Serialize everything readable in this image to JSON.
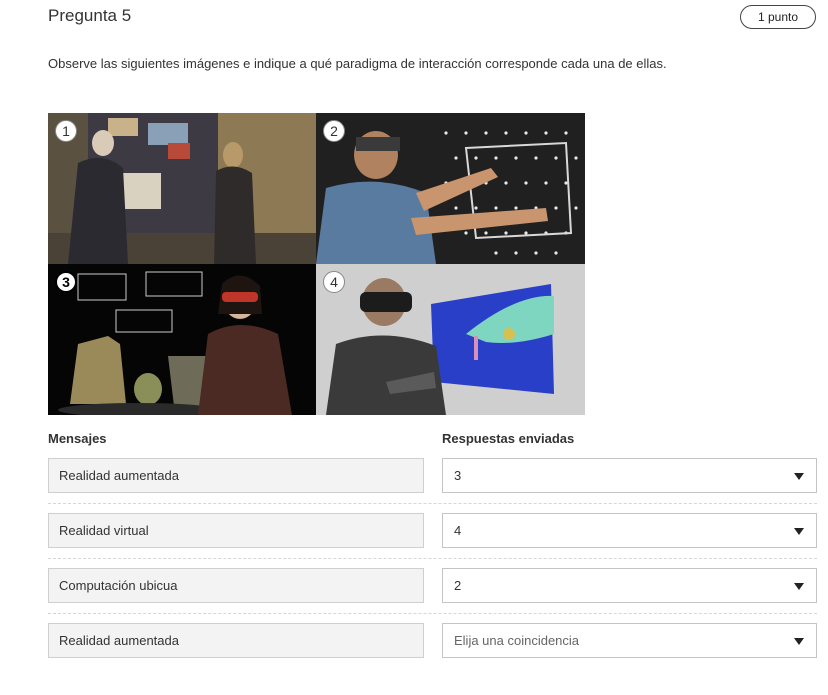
{
  "question": {
    "title": "Pregunta 5",
    "points": "1 punto",
    "instructions": "Observe las siguientes imágenes e indique a qué paradigma de interacción corresponde cada una de ellas."
  },
  "figure": {
    "panels": [
      {
        "number": "1",
        "icon": "people-at-display-wall"
      },
      {
        "number": "2",
        "icon": "man-with-headset-at-pegboard"
      },
      {
        "number": "3",
        "icon": "woman-with-glasses-museum-artifacts"
      },
      {
        "number": "4",
        "icon": "man-with-vr-headset-and-gloves"
      }
    ]
  },
  "matching": {
    "header_left": "Mensajes",
    "header_right": "Respuestas enviadas",
    "rows": [
      {
        "message": "Realidad aumentada",
        "answer": "3"
      },
      {
        "message": "Realidad virtual",
        "answer": "4"
      },
      {
        "message": "Computación ubicua",
        "answer": "2"
      },
      {
        "message": "Realidad aumentada",
        "answer": "Elija una coincidencia"
      }
    ]
  },
  "colors": {
    "text": "#333333",
    "field_bg": "#f3f3f3",
    "border": "#c4c4c4"
  }
}
